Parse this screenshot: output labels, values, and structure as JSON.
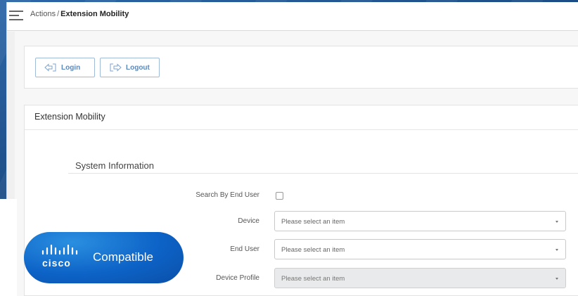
{
  "topbar": {
    "menu_icon": "hamburger-menu-icon",
    "breadcrumb": {
      "parent": "Actions",
      "separator": "/",
      "current": "Extension Mobility"
    }
  },
  "actions": {
    "login_label": "Login",
    "login_icon": "login-arrow-icon",
    "logout_label": "Logout",
    "logout_icon": "logout-arrow-icon"
  },
  "panel": {
    "title": "Extension Mobility",
    "section_title": "System Information",
    "fields": {
      "search_by_end_user": {
        "label": "Search By End User",
        "checked": false
      },
      "device": {
        "label": "Device",
        "value": "Please select an item"
      },
      "end_user": {
        "label": "End User",
        "value": "Please select an item"
      },
      "device_profile": {
        "label": "Device Profile",
        "value": "Please select an item",
        "disabled": true
      }
    }
  },
  "badge": {
    "brand": "cisco",
    "text": "Compatible"
  },
  "colors": {
    "accent": "#5e88b8",
    "badge_blue": "#0d63c7",
    "background_blue": "#1e4e86"
  }
}
